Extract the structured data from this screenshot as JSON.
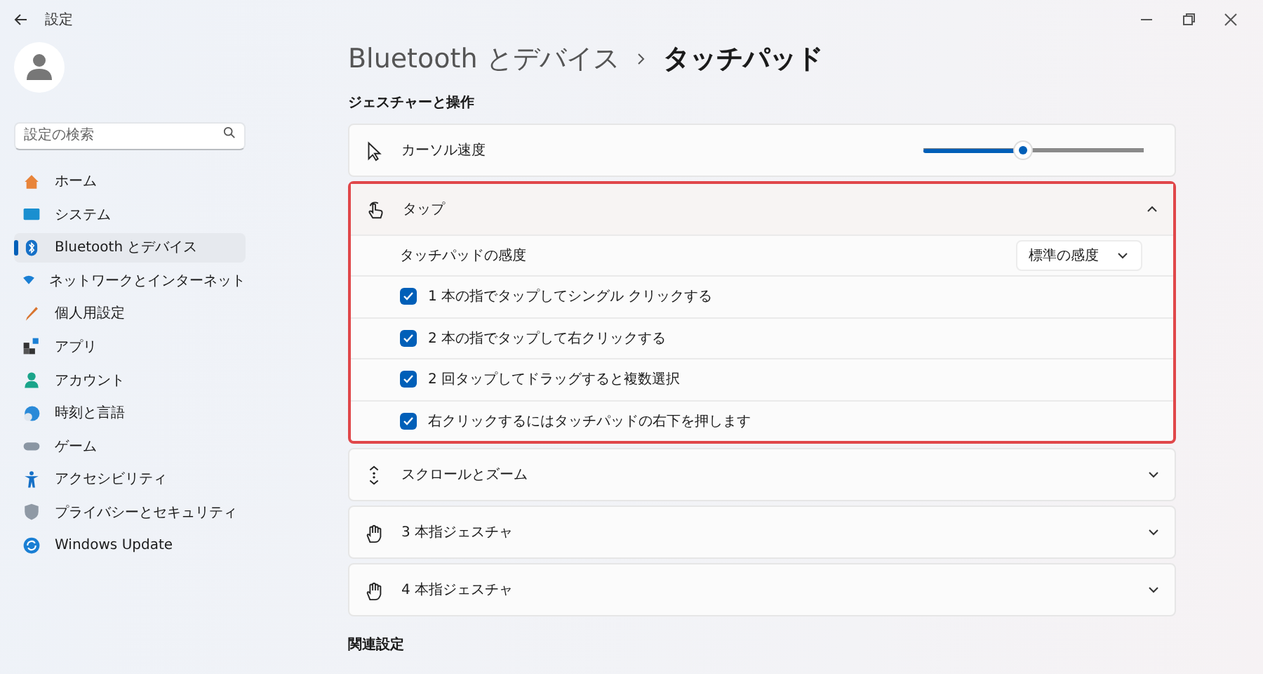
{
  "window": {
    "title": "設定"
  },
  "sidebar": {
    "search": {
      "placeholder": "設定の検索"
    },
    "items": [
      {
        "label": "ホーム",
        "selected": false
      },
      {
        "label": "システム",
        "selected": false
      },
      {
        "label": "Bluetooth とデバイス",
        "selected": true
      },
      {
        "label": "ネットワークとインターネット",
        "selected": false
      },
      {
        "label": "個人用設定",
        "selected": false
      },
      {
        "label": "アプリ",
        "selected": false
      },
      {
        "label": "アカウント",
        "selected": false
      },
      {
        "label": "時刻と言語",
        "selected": false
      },
      {
        "label": "ゲーム",
        "selected": false
      },
      {
        "label": "アクセシビリティ",
        "selected": false
      },
      {
        "label": "プライバシーとセキュリティ",
        "selected": false
      },
      {
        "label": "Windows Update",
        "selected": false
      }
    ]
  },
  "main": {
    "breadcrumb": [
      "Bluetooth とデバイス",
      "タッチパッド"
    ],
    "section": "ジェスチャーと操作",
    "cards": [
      {
        "kind": "slider",
        "label": "カーソル速度",
        "level": 0.45
      },
      {
        "kind": "expander",
        "label": "タップ",
        "expanded": true,
        "highlighted": true,
        "rows": [
          {
            "kind": "dropdown",
            "label": "タッチパッドの感度",
            "value": "標準の感度"
          },
          {
            "kind": "checkbox",
            "label": "1 本の指でタップしてシングル クリックする",
            "checked": true
          },
          {
            "kind": "checkbox",
            "label": "2 本の指でタップして右クリックする",
            "checked": true
          },
          {
            "kind": "checkbox",
            "label": "2 回タップしてドラッグすると複数選択",
            "checked": true
          },
          {
            "kind": "checkbox",
            "label": "右クリックするにはタッチパッドの右下を押します",
            "checked": true
          }
        ]
      },
      {
        "kind": "expander",
        "label": "スクロールとズーム",
        "expanded": false,
        "highlighted": false
      },
      {
        "kind": "expander",
        "label": "3 本指ジェスチャ",
        "expanded": false,
        "highlighted": false
      },
      {
        "kind": "expander",
        "label": "4 本指ジェスチャ",
        "expanded": false,
        "highlighted": false
      }
    ],
    "related": "関連設定"
  }
}
